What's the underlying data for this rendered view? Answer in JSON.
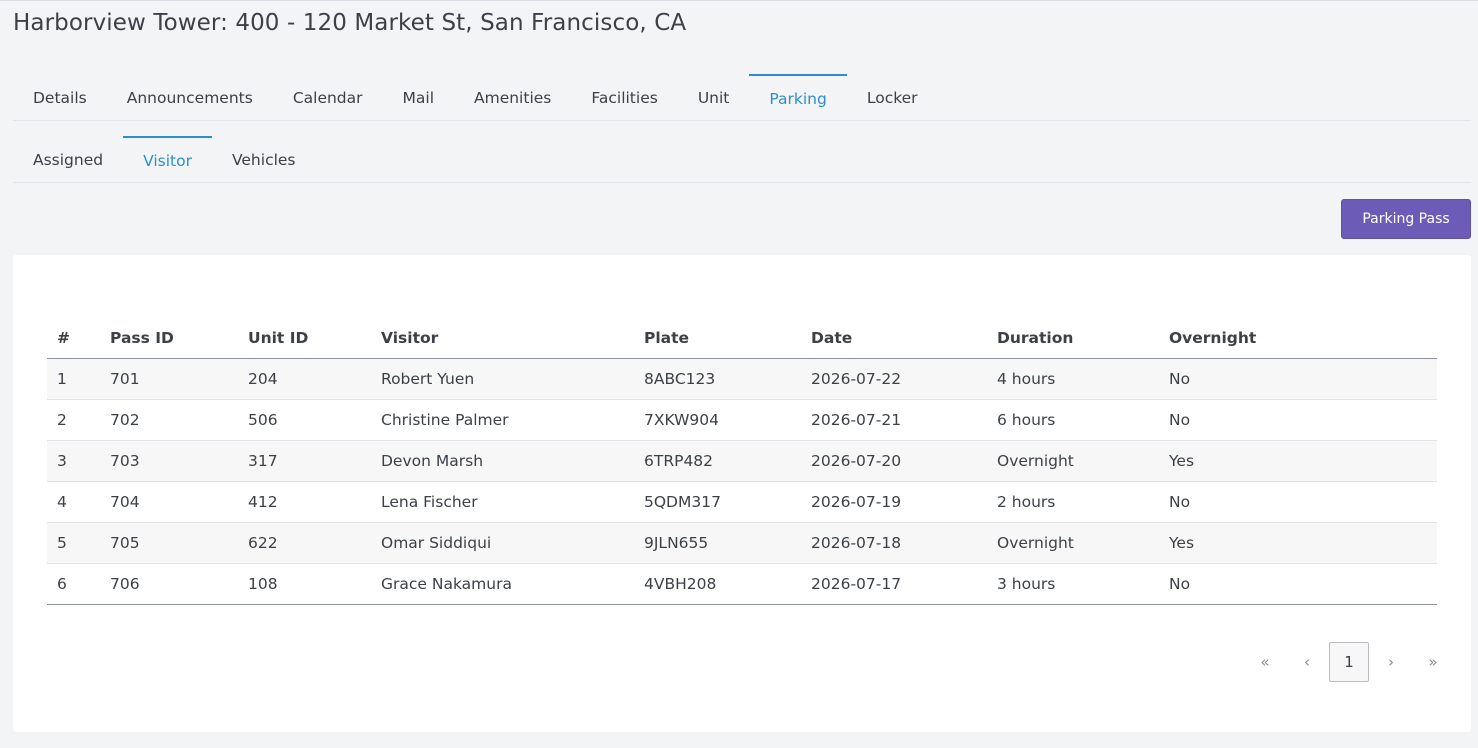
{
  "page": {
    "title": "Harborview Tower: 400 - 120 Market St, San Francisco, CA"
  },
  "main_tabs": [
    {
      "label": "Details",
      "active": false
    },
    {
      "label": "Announcements",
      "active": false
    },
    {
      "label": "Calendar",
      "active": false
    },
    {
      "label": "Mail",
      "active": false
    },
    {
      "label": "Amenities",
      "active": false
    },
    {
      "label": "Facilities",
      "active": false
    },
    {
      "label": "Unit",
      "active": false
    },
    {
      "label": "Parking",
      "active": true
    },
    {
      "label": "Locker",
      "active": false
    }
  ],
  "sub_tabs": [
    {
      "label": "Assigned",
      "active": false
    },
    {
      "label": "Visitor",
      "active": true
    },
    {
      "label": "Vehicles",
      "active": false
    }
  ],
  "toolbar": {
    "parking_pass_label": "Parking Pass"
  },
  "table": {
    "columns": [
      "#",
      "Pass ID",
      "Unit ID",
      "Visitor",
      "Plate",
      "Date",
      "Duration",
      "Overnight"
    ],
    "rows": [
      [
        "1",
        "701",
        "204",
        "Robert Yuen",
        "8ABC123",
        "2026-07-22",
        "4 hours",
        "No"
      ],
      [
        "2",
        "702",
        "506",
        "Christine Palmer",
        "7XKW904",
        "2026-07-21",
        "6 hours",
        "No"
      ],
      [
        "3",
        "703",
        "317",
        "Devon Marsh",
        "6TRP482",
        "2026-07-20",
        "Overnight",
        "Yes"
      ],
      [
        "4",
        "704",
        "412",
        "Lena Fischer",
        "5QDM317",
        "2026-07-19",
        "2 hours",
        "No"
      ],
      [
        "5",
        "705",
        "622",
        "Omar Siddiqui",
        "9JLN655",
        "2026-07-18",
        "Overnight",
        "Yes"
      ],
      [
        "6",
        "706",
        "108",
        "Grace Nakamura",
        "4VBH208",
        "2026-07-17",
        "3 hours",
        "No"
      ]
    ]
  },
  "pagination": {
    "first": "«",
    "prev": "‹",
    "current": "1",
    "next": "›",
    "last": "»"
  },
  "colors": {
    "accent": "#2d8ecf",
    "button": "#6c5cb8",
    "background": "#f3f4f6"
  }
}
